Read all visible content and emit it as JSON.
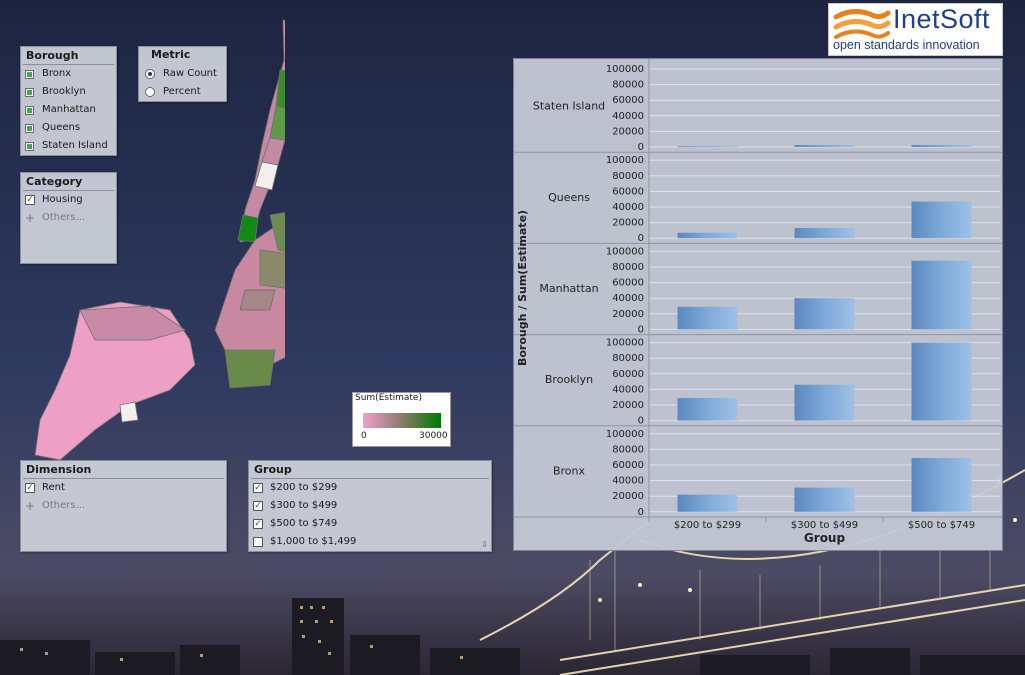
{
  "logo": {
    "brand": "InetSoft",
    "tagline": "open standards innovation",
    "brand_color": "#e8821e",
    "tagline_color": "#1f3f8a"
  },
  "borough_filter": {
    "title": "Borough",
    "items": [
      {
        "label": "Bronx",
        "selected": true
      },
      {
        "label": "Brooklyn",
        "selected": true
      },
      {
        "label": "Manhattan",
        "selected": true
      },
      {
        "label": "Queens",
        "selected": true
      },
      {
        "label": "Staten Island",
        "selected": true
      }
    ]
  },
  "metric": {
    "title": "Metric",
    "options": [
      {
        "label": "Raw Count",
        "selected": true
      },
      {
        "label": "Percent",
        "selected": false
      }
    ]
  },
  "category_filter": {
    "title": "Category",
    "items": [
      {
        "label": "Housing",
        "checked": true
      },
      {
        "label": "Others...",
        "checked": false
      }
    ]
  },
  "dimension_filter": {
    "title": "Dimension",
    "items": [
      {
        "label": "Rent",
        "checked": true
      },
      {
        "label": "Others...",
        "checked": false
      }
    ]
  },
  "group_filter": {
    "title": "Group",
    "items": [
      {
        "label": "$200 to $299",
        "checked": true
      },
      {
        "label": "$300 to $499",
        "checked": true
      },
      {
        "label": "$500 to $749",
        "checked": true
      },
      {
        "label": "$1,000 to $1,499",
        "checked": false
      }
    ]
  },
  "map_legend": {
    "title": "Sum(Estimate)",
    "min_label": "0",
    "max_label": "30000",
    "low_color": "#f2a0cc",
    "mid_color": "#8a7a6a",
    "high_color": "#007a00"
  },
  "colors": {
    "bar": "#7ea9d8",
    "bar_dark": "#5b88c0",
    "chart_bg": "#c4c8d4"
  },
  "chart_data": {
    "type": "bar",
    "facet_by": "Borough",
    "xlabel": "Group",
    "ylabel": "Borough / Sum(Estimate)",
    "categories": [
      "$200 to $299",
      "$300 to $499",
      "$500 to $749"
    ],
    "y_ticks": [
      "100000",
      "80000",
      "60000",
      "40000",
      "20000",
      "0"
    ],
    "ylim": [
      0,
      100000
    ],
    "grid": true,
    "series": [
      {
        "name": "Staten Island",
        "values": [
          800,
          2500,
          2500
        ]
      },
      {
        "name": "Queens",
        "values": [
          7000,
          13000,
          47000
        ]
      },
      {
        "name": "Manhattan",
        "values": [
          29000,
          40000,
          88000
        ]
      },
      {
        "name": "Brooklyn",
        "values": [
          29000,
          46000,
          100000
        ]
      },
      {
        "name": "Bronx",
        "values": [
          22000,
          31000,
          69000
        ]
      }
    ]
  }
}
